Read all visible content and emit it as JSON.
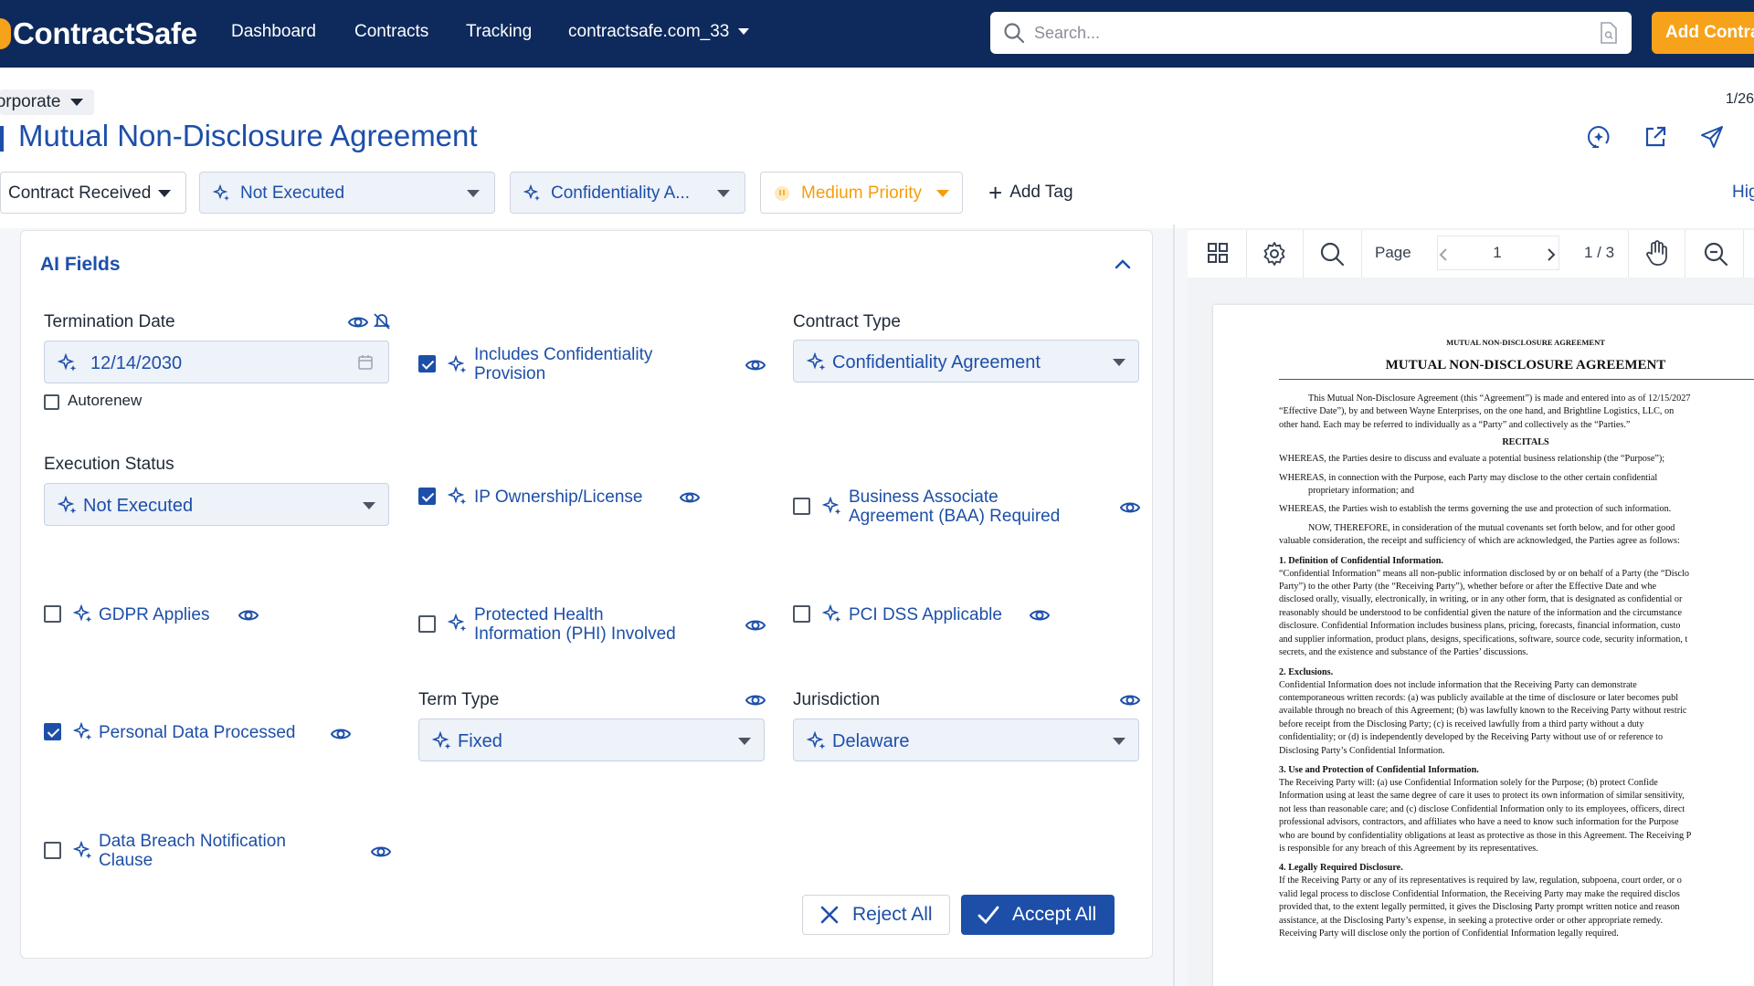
{
  "nav": {
    "brand": "ContractSafe",
    "links": [
      "Dashboard",
      "Contracts",
      "Tracking"
    ],
    "account": "contractsafe.com_33",
    "search_placeholder": "Search...",
    "add_button": "Add Contract"
  },
  "header": {
    "breadcrumb": "Corporate",
    "counter": "1/26",
    "title": "Mutual Non-Disclosure Agreement",
    "tags": {
      "status": "Contract Received",
      "execution": "Not Executed",
      "type": "Confidentiality A...",
      "priority": "Medium Priority",
      "add_tag": "Add Tag",
      "highlight": "Hig"
    }
  },
  "ai_fields": {
    "title": "AI Fields",
    "termination_date": {
      "label": "Termination Date",
      "value": "12/14/2030",
      "autorenew": "Autorenew"
    },
    "execution_status": {
      "label": "Execution Status",
      "value": "Not Executed"
    },
    "contract_type": {
      "label": "Contract Type",
      "value": "Confidentiality Agreement"
    },
    "term_type": {
      "label": "Term Type",
      "value": "Fixed"
    },
    "jurisdiction": {
      "label": "Jurisdiction",
      "value": "Delaware"
    },
    "checkboxes": {
      "confidentiality": {
        "l1": "Includes Confidentiality",
        "l2": "Provision",
        "checked": true
      },
      "ip": {
        "l1": "IP Ownership/License",
        "checked": true
      },
      "baa": {
        "l1": "Business Associate",
        "l2": "Agreement (BAA) Required",
        "checked": false
      },
      "gdpr": {
        "l1": "GDPR Applies",
        "checked": false
      },
      "phi": {
        "l1": "Protected Health",
        "l2": "Information (PHI) Involved",
        "checked": false
      },
      "pci": {
        "l1": "PCI DSS Applicable",
        "checked": false
      },
      "personal": {
        "l1": "Personal Data Processed",
        "checked": true
      },
      "breach": {
        "l1": "Data Breach Notification",
        "l2": "Clause",
        "checked": false
      }
    },
    "reject_all": "Reject All",
    "accept_all": "Accept All"
  },
  "viewer": {
    "page_label": "Page",
    "page_value": "1",
    "page_total": "1 / 3"
  },
  "document": {
    "running_head": "MUTUAL NON-DISCLOSURE AGREEMENT",
    "title": "MUTUAL NON-DISCLOSURE AGREEMENT",
    "intro1": "This Mutual Non-Disclosure Agreement (this “Agreement”) is made and entered into as of 12/15/2027",
    "intro2": "“Effective Date”), by and between Wayne Enterprises, on the one hand, and Brightline Logistics, LLC, on",
    "intro3": "other hand. Each may be referred to individually as a “Party” and collectively as the “Parties.”",
    "recitals": "RECITALS",
    "w1": "WHEREAS, the Parties desire to discuss and evaluate a potential business relationship (the “Purpose”);",
    "w2a": "WHEREAS, in connection with the Purpose, each Party may disclose to the other certain confidential",
    "w2b": "proprietary information; and",
    "w3": "WHEREAS, the Parties wish to establish the terms governing the use and protection of such information.",
    "now1": "NOW, THEREFORE, in consideration of the mutual covenants set forth below, and for other good",
    "now2": "valuable consideration, the receipt and sufficiency of which are acknowledged, the Parties agree as follows:",
    "h1": "1. Definition of Confidential Information.",
    "p1": [
      "“Confidential Information” means all non-public information disclosed by or on behalf of a Party (the “Disclo",
      "Party”) to the other Party (the “Receiving Party”), whether before or after the Effective Date and whe",
      "disclosed orally, visually, electronically, in writing, or in any other form, that is designated as confidential or",
      "reasonably should be understood to be confidential given the nature of the information and the circumstance",
      "disclosure. Confidential Information includes business plans, pricing, forecasts, financial information, custo",
      "and supplier information, product plans, designs, specifications, software, source code, security information, t",
      "secrets, and the existence and substance of the Parties’ discussions."
    ],
    "h2": "2. Exclusions.",
    "p2": [
      "Confidential Information does not include information that the Receiving Party can demonstrate",
      "contemporaneous written records: (a) was publicly available at the time of disclosure or later becomes publ",
      "available through no breach of this Agreement; (b) was lawfully known to the Receiving Party without restric",
      "before receipt from the Disclosing Party; (c) is received lawfully from a third party without a duty",
      "confidentiality; or (d) is independently developed by the Receiving Party without use of or reference to",
      "Disclosing Party’s Confidential Information."
    ],
    "h3": "3. Use and Protection of Confidential Information.",
    "p3": [
      "The Receiving Party will: (a) use Confidential Information solely for the Purpose; (b) protect Confide",
      "Information using at least the same degree of care it uses to protect its own information of similar sensitivity,",
      "not less than reasonable care; and (c) disclose Confidential Information only to its employees, officers, direct",
      "professional advisors, contractors, and affiliates who have a need to know such information for the Purpose",
      "who are bound by confidentiality obligations at least as protective as those in this Agreement. The Receiving P",
      "is responsible for any breach of this Agreement by its representatives."
    ],
    "h4": "4. Legally Required Disclosure.",
    "p4": [
      "If the Receiving Party or any of its representatives is required by law, regulation, subpoena, court order, or o",
      "valid legal process to disclose Confidential Information, the Receiving Party may make the required disclos",
      "provided that, to the extent legally permitted, it gives the Disclosing Party prompt written notice and reason",
      "assistance, at the Disclosing Party’s expense, in seeking a protective order or other appropriate remedy.",
      "Receiving Party will disclose only the portion of Confidential Information legally required."
    ]
  },
  "colors": {
    "nav_bg": "#0e2a5c",
    "accent": "#1d4fa8",
    "orange": "#f7a21b",
    "priority": "#f59e0b"
  },
  "icons": [
    "search-icon",
    "document-search-icon",
    "chat-sparkle-icon",
    "external-link-icon",
    "send-icon",
    "sparkle-icon",
    "eye-icon",
    "bell-off-icon",
    "calendar-icon",
    "chevron-up-icon",
    "grid-icon",
    "gear-icon",
    "hand-icon",
    "zoom-out-icon",
    "close-icon",
    "check-icon",
    "chevron-left-icon",
    "chevron-right-icon",
    "plus-icon"
  ]
}
